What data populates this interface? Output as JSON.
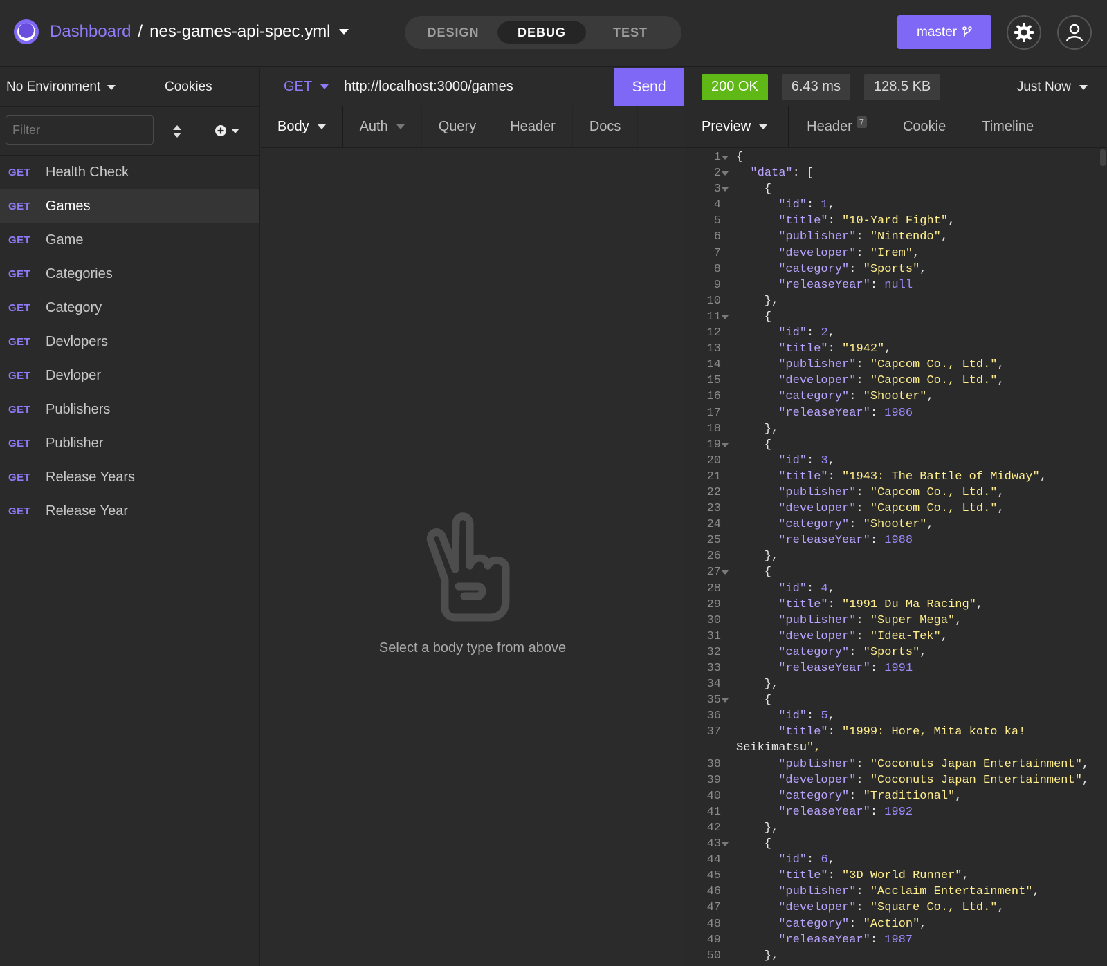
{
  "header": {
    "dashboard": "Dashboard",
    "separator": "/",
    "file": "nes-games-api-spec.yml",
    "modes": [
      "DESIGN",
      "DEBUG",
      "TEST"
    ],
    "active_mode": "DEBUG",
    "branch": "master"
  },
  "sidebar": {
    "environment": "No Environment",
    "cookies": "Cookies",
    "filter_placeholder": "Filter",
    "requests": [
      {
        "method": "GET",
        "name": "Health Check"
      },
      {
        "method": "GET",
        "name": "Games"
      },
      {
        "method": "GET",
        "name": "Game"
      },
      {
        "method": "GET",
        "name": "Categories"
      },
      {
        "method": "GET",
        "name": "Category"
      },
      {
        "method": "GET",
        "name": "Devlopers"
      },
      {
        "method": "GET",
        "name": "Devloper"
      },
      {
        "method": "GET",
        "name": "Publishers"
      },
      {
        "method": "GET",
        "name": "Publisher"
      },
      {
        "method": "GET",
        "name": "Release Years"
      },
      {
        "method": "GET",
        "name": "Release Year"
      }
    ],
    "active_request": "Games"
  },
  "request": {
    "method": "GET",
    "url": "http://localhost:3000/games",
    "send": "Send",
    "tabs": [
      "Body",
      "Auth",
      "Query",
      "Header",
      "Docs"
    ],
    "empty_message": "Select a body type from above"
  },
  "response": {
    "status": "200 OK",
    "time": "6.43 ms",
    "size": "128.5 KB",
    "when": "Just Now",
    "tabs": [
      "Preview",
      "Header",
      "Cookie",
      "Timeline"
    ],
    "header_count": "7",
    "lines": [
      {
        "n": "1",
        "fold": true,
        "t": "{"
      },
      {
        "n": "2",
        "fold": true,
        "t": "  \"data\": ["
      },
      {
        "n": "3",
        "fold": true,
        "t": "    {"
      },
      {
        "n": "4",
        "t": "      \"id\": 1,"
      },
      {
        "n": "5",
        "t": "      \"title\": \"10-Yard Fight\","
      },
      {
        "n": "6",
        "t": "      \"publisher\": \"Nintendo\","
      },
      {
        "n": "7",
        "t": "      \"developer\": \"Irem\","
      },
      {
        "n": "8",
        "t": "      \"category\": \"Sports\","
      },
      {
        "n": "9",
        "t": "      \"releaseYear\": null"
      },
      {
        "n": "10",
        "t": "    },"
      },
      {
        "n": "11",
        "fold": true,
        "t": "    {"
      },
      {
        "n": "12",
        "t": "      \"id\": 2,"
      },
      {
        "n": "13",
        "t": "      \"title\": \"1942\","
      },
      {
        "n": "14",
        "t": "      \"publisher\": \"Capcom Co., Ltd.\","
      },
      {
        "n": "15",
        "t": "      \"developer\": \"Capcom Co., Ltd.\","
      },
      {
        "n": "16",
        "t": "      \"category\": \"Shooter\","
      },
      {
        "n": "17",
        "t": "      \"releaseYear\": 1986"
      },
      {
        "n": "18",
        "t": "    },"
      },
      {
        "n": "19",
        "fold": true,
        "t": "    {"
      },
      {
        "n": "20",
        "t": "      \"id\": 3,"
      },
      {
        "n": "21",
        "t": "      \"title\": \"1943: The Battle of Midway\","
      },
      {
        "n": "22",
        "t": "      \"publisher\": \"Capcom Co., Ltd.\","
      },
      {
        "n": "23",
        "t": "      \"developer\": \"Capcom Co., Ltd.\","
      },
      {
        "n": "24",
        "t": "      \"category\": \"Shooter\","
      },
      {
        "n": "25",
        "t": "      \"releaseYear\": 1988"
      },
      {
        "n": "26",
        "t": "    },"
      },
      {
        "n": "27",
        "fold": true,
        "t": "    {"
      },
      {
        "n": "28",
        "t": "      \"id\": 4,"
      },
      {
        "n": "29",
        "t": "      \"title\": \"1991 Du Ma Racing\","
      },
      {
        "n": "30",
        "t": "      \"publisher\": \"Super Mega\","
      },
      {
        "n": "31",
        "t": "      \"developer\": \"Idea-Tek\","
      },
      {
        "n": "32",
        "t": "      \"category\": \"Sports\","
      },
      {
        "n": "33",
        "t": "      \"releaseYear\": 1991"
      },
      {
        "n": "34",
        "t": "    },"
      },
      {
        "n": "35",
        "fold": true,
        "t": "    {"
      },
      {
        "n": "36",
        "t": "      \"id\": 5,"
      },
      {
        "n": "37",
        "t": "      \"title\": \"1999: Hore, Mita koto ka!"
      },
      {
        "n": "",
        "t": "Seikimatsu\","
      },
      {
        "n": "38",
        "t": "      \"publisher\": \"Coconuts Japan Entertainment\","
      },
      {
        "n": "39",
        "t": "      \"developer\": \"Coconuts Japan Entertainment\","
      },
      {
        "n": "40",
        "t": "      \"category\": \"Traditional\","
      },
      {
        "n": "41",
        "t": "      \"releaseYear\": 1992"
      },
      {
        "n": "42",
        "t": "    },"
      },
      {
        "n": "43",
        "fold": true,
        "t": "    {"
      },
      {
        "n": "44",
        "t": "      \"id\": 6,"
      },
      {
        "n": "45",
        "t": "      \"title\": \"3D World Runner\","
      },
      {
        "n": "46",
        "t": "      \"publisher\": \"Acclaim Entertainment\","
      },
      {
        "n": "47",
        "t": "      \"developer\": \"Square Co., Ltd.\","
      },
      {
        "n": "48",
        "t": "      \"category\": \"Action\","
      },
      {
        "n": "49",
        "t": "      \"releaseYear\": 1987"
      },
      {
        "n": "50",
        "t": "    },"
      }
    ]
  },
  "colors": {
    "accent": "#7e68f5",
    "status_ok": "#5fb815",
    "json_key": "#b9a4ff",
    "json_string": "#ffee8c",
    "json_number": "#9f8cff"
  }
}
